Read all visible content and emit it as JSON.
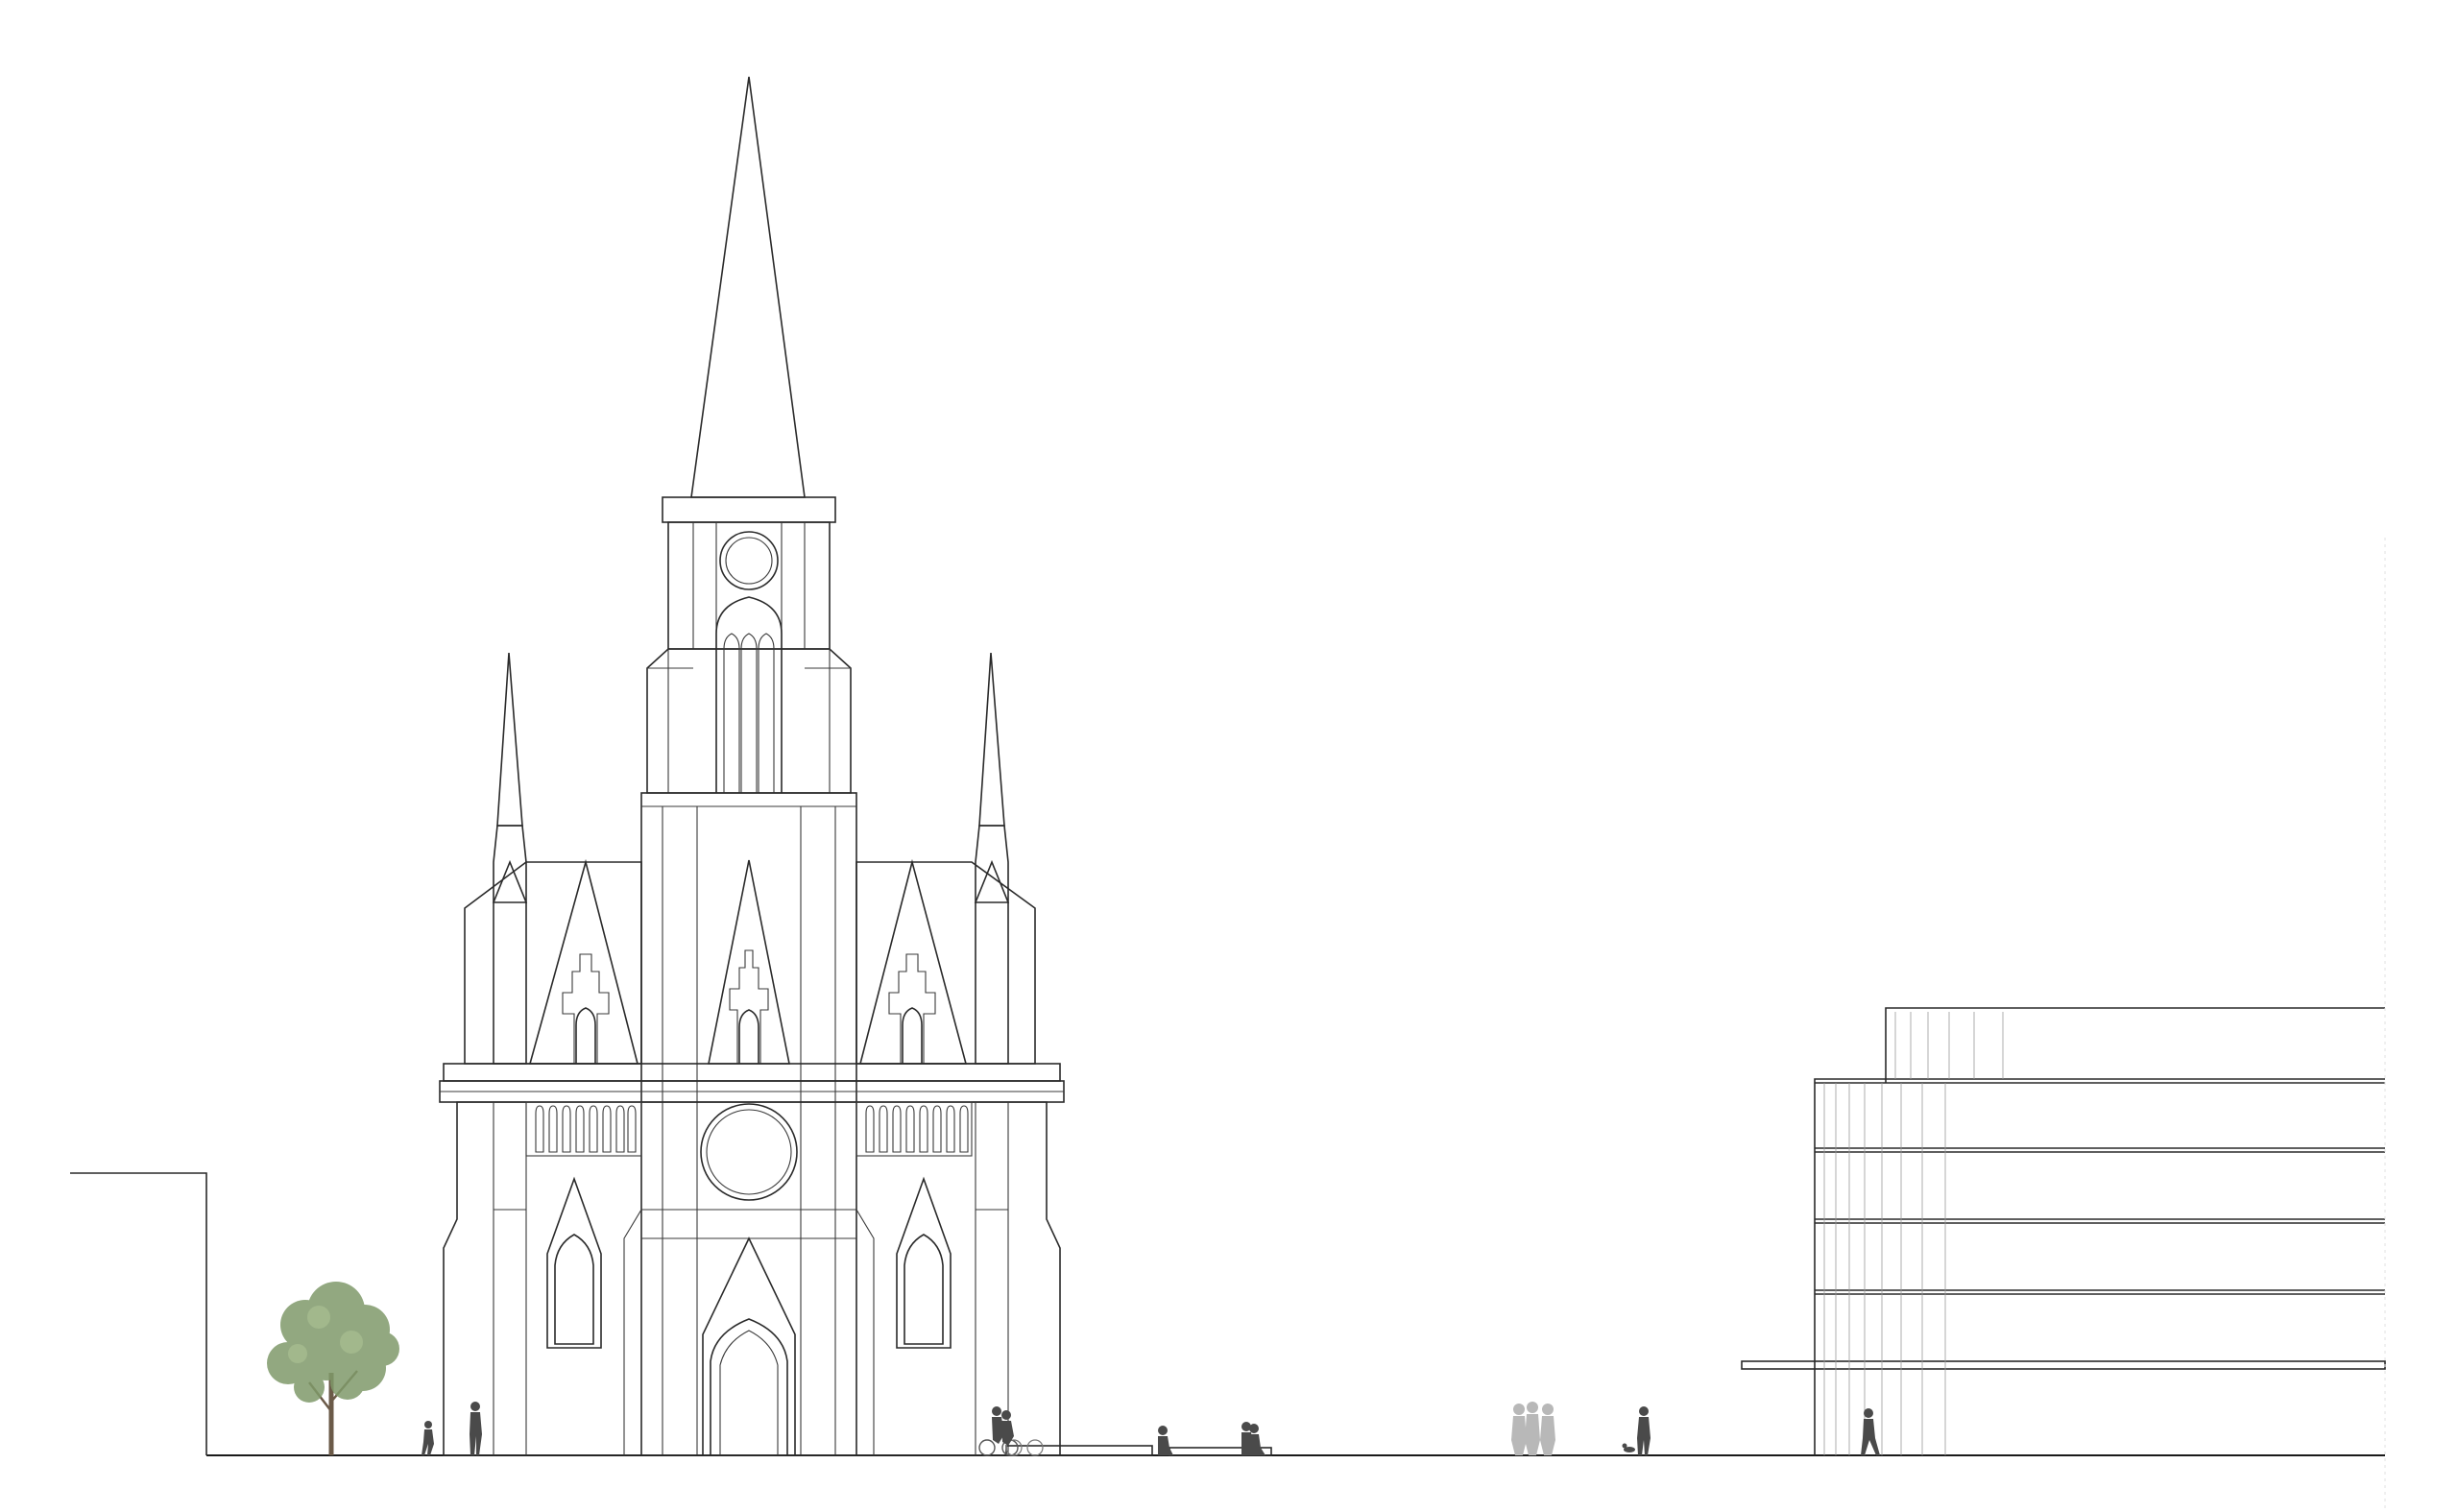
{
  "drawing": {
    "kind": "architectural street elevation",
    "background": "#ffffff",
    "line_color": "#2a2a2a",
    "tree_color": "#7f9a6a",
    "figure_color": "#4a4a4a",
    "ghost_figure_color": "#b8b8b8",
    "elements": [
      "gothic-church-facade",
      "office-building",
      "low-wall-building",
      "street-tree",
      "pedestrian-figures",
      "benches",
      "cyclists"
    ]
  }
}
